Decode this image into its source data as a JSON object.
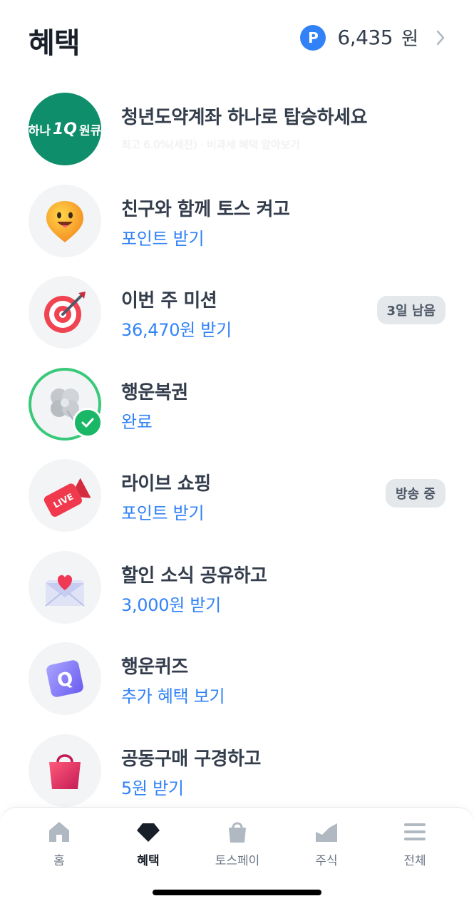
{
  "header": {
    "title": "혜택",
    "points_badge": "P",
    "points_amount": "6,435",
    "points_unit": "원"
  },
  "hana_logo": {
    "left": "하나",
    "mid": "1Q",
    "right": "원큐"
  },
  "items": [
    {
      "title": "청년도약계좌 하나로 탑승하세요",
      "subtitle": "최고 6.0%(세전) · 비과세 혜택 알아보기",
      "icon": "hana-1q-logo"
    },
    {
      "title": "친구와 함께 토스 켜고",
      "subtitle": "포인트 받기",
      "icon": "smiley-pin-icon"
    },
    {
      "title": "이번 주 미션",
      "subtitle": "36,470원 받기",
      "badge": "3일 남음",
      "icon": "target-dart-icon"
    },
    {
      "title": "행운복권",
      "subtitle": "완료",
      "icon": "clover-icon"
    },
    {
      "title": "라이브 쇼핑",
      "subtitle": "포인트 받기",
      "badge": "방송 중",
      "icon": "live-tv-icon"
    },
    {
      "title": "할인 소식 공유하고",
      "subtitle": "3,000원 받기",
      "icon": "heart-envelope-icon"
    },
    {
      "title": "행운퀴즈",
      "subtitle": "추가 혜택 보기",
      "icon": "quiz-cube-icon"
    },
    {
      "title": "공동구매 구경하고",
      "subtitle": "5원 받기",
      "icon": "shopping-bag-icon"
    }
  ],
  "tabs": [
    {
      "label": "홈",
      "icon": "home-icon"
    },
    {
      "label": "혜택",
      "icon": "diamond-icon",
      "active": true
    },
    {
      "label": "토스페이",
      "icon": "bag-icon"
    },
    {
      "label": "주식",
      "icon": "stock-chart-icon"
    },
    {
      "label": "전체",
      "icon": "menu-icon"
    }
  ],
  "colors": {
    "accent": "#3182f6",
    "done": "#1ab767",
    "hana": "#0f8e6b",
    "text": "#333d4b"
  }
}
